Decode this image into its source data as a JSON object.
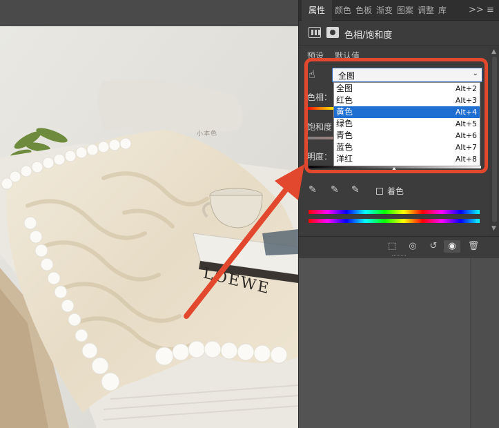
{
  "tabs": {
    "active": "属性",
    "others": [
      "颜色",
      "色板",
      "渐变",
      "图案",
      "调整",
      "库"
    ],
    "overflow": ">>",
    "menu_icon": "hamburger-menu-icon"
  },
  "panel": {
    "title": "色相/饱和度",
    "preset_label": "预设",
    "preset_value": "默认值",
    "hue_label": "色相：",
    "saturation_label": "饱和度",
    "lightness_label": "明度：",
    "colorize_label": "着色"
  },
  "range_select": {
    "value": "全图",
    "options": [
      {
        "name": "全图",
        "shortcut": "Alt+2"
      },
      {
        "name": "红色",
        "shortcut": "Alt+3"
      },
      {
        "name": "黄色",
        "shortcut": "Alt+4"
      },
      {
        "name": "绿色",
        "shortcut": "Alt+5"
      },
      {
        "name": "青色",
        "shortcut": "Alt+6"
      },
      {
        "name": "蓝色",
        "shortcut": "Alt+7"
      },
      {
        "name": "洋红",
        "shortcut": "Alt+8"
      }
    ],
    "highlighted": "黄色"
  },
  "photo": {
    "book_text": "LOEWE",
    "pillow_text": "小本色"
  },
  "colors": {
    "annotation": "#e2482d",
    "selection": "#1f6ed2",
    "panel_bg": "#3c3c3c"
  }
}
